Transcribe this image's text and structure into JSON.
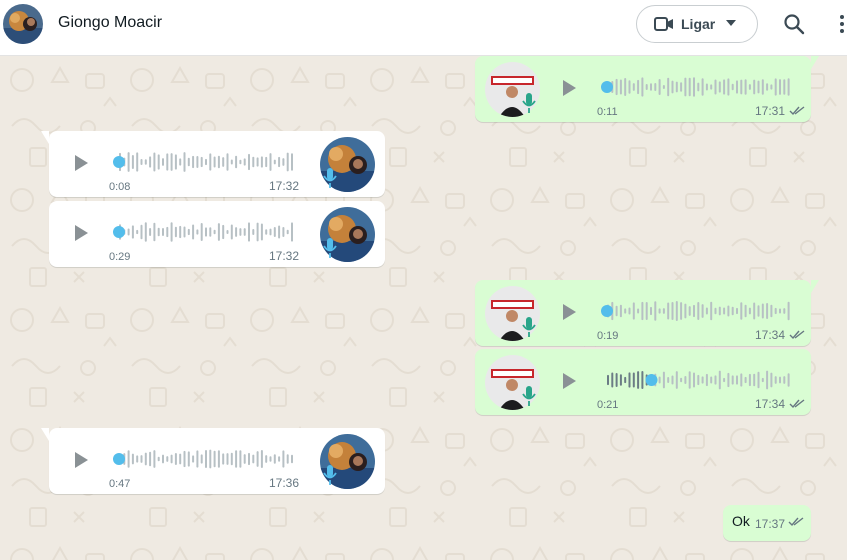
{
  "header": {
    "contact_name": "Giongo Moacir",
    "call_label": "Ligar",
    "icons": [
      "video-icon",
      "chevron-down-icon",
      "search-icon",
      "menu-icon"
    ]
  },
  "colors": {
    "incoming_bubble": "#ffffff",
    "outgoing_bubble": "#d9fdd3",
    "chat_background": "#efeae2",
    "progress_dot": "#53bdeb",
    "waveform_unplayed": "#b7c0c4",
    "waveform_played_out": "#6b7c85"
  },
  "messages": [
    {
      "direction": "out",
      "type": "voice",
      "duration": "0:11",
      "time": "17:31",
      "status": "read",
      "progress": 0
    },
    {
      "direction": "in",
      "type": "voice",
      "duration": "0:08",
      "time": "17:32",
      "progress": 0
    },
    {
      "direction": "in",
      "type": "voice",
      "duration": "0:29",
      "time": "17:32",
      "progress": 0
    },
    {
      "direction": "out",
      "type": "voice",
      "duration": "0:19",
      "time": "17:34",
      "status": "read",
      "progress": 0
    },
    {
      "direction": "out",
      "type": "voice",
      "duration": "0:21",
      "time": "17:34",
      "status": "read",
      "progress": 0.25
    },
    {
      "direction": "in",
      "type": "voice",
      "duration": "0:47",
      "time": "17:36",
      "progress": 0
    },
    {
      "direction": "out",
      "type": "text",
      "text": "Ok",
      "time": "17:37",
      "status": "read"
    }
  ]
}
